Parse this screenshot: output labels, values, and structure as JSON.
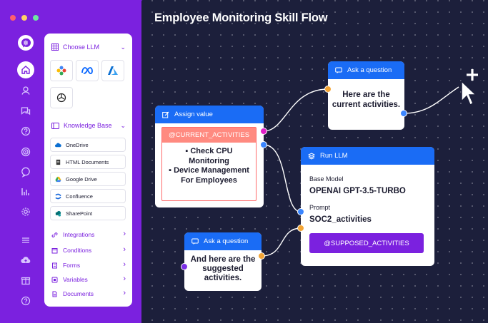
{
  "window": {
    "controls": [
      "close",
      "minimize",
      "maximize"
    ]
  },
  "rail": {
    "icons": [
      "logo-icon",
      "home-icon",
      "user-icon",
      "chat-icon",
      "help-icon",
      "target-icon",
      "bubble-icon",
      "chart-icon",
      "settings-icon",
      "menu-icon",
      "cloud-upload-icon",
      "gift-icon",
      "question-icon"
    ]
  },
  "panel": {
    "choose_llm": {
      "label": "Choose LLM",
      "models": [
        "gemini-icon",
        "meta-icon",
        "azure-icon",
        "openai-icon"
      ]
    },
    "knowledge_base": {
      "label": "Knowledge Base",
      "items": [
        {
          "label": "OneDrive",
          "icon": "onedrive-icon"
        },
        {
          "label": "HTML Documents",
          "icon": "document-icon"
        },
        {
          "label": "Google Drive",
          "icon": "google-drive-icon"
        },
        {
          "label": "Confluence",
          "icon": "confluence-icon"
        },
        {
          "label": "SharePoint",
          "icon": "sharepoint-icon"
        }
      ]
    },
    "menu": [
      {
        "label": "Integrations"
      },
      {
        "label": "Conditions"
      },
      {
        "label": "Forms"
      },
      {
        "label": "Variables"
      },
      {
        "label": "Documents"
      }
    ]
  },
  "canvas": {
    "title": "Employee Monitoring Skill Flow",
    "nodes": {
      "ask1": {
        "header": "Ask a question",
        "text_line1": "Here are the",
        "text_line2": "current activities."
      },
      "assign": {
        "header": "Assign value",
        "variable": "@CURRENT_ACTIVITIES",
        "items": [
          "Check CPU Monitoring",
          "Device Management For Employees"
        ]
      },
      "llm": {
        "header": "Run LLM",
        "base_model_label": "Base Model",
        "base_model_value": "OPENAI GPT-3.5-TURBO",
        "prompt_label": "Prompt",
        "prompt_value": "SOC2_activities",
        "output_variable": "@SUPPOSED_ACTIVITIES"
      },
      "ask2": {
        "header": "Ask a question",
        "text_line1": "And here are the",
        "text_line2": "suggested",
        "text_line3": "activities."
      }
    }
  },
  "colors": {
    "accent": "#7b21df",
    "canvas": "#1c1f3b",
    "node_header": "#1a6cf5",
    "port_orange": "#f4a535",
    "port_blue": "#3b86ff"
  }
}
